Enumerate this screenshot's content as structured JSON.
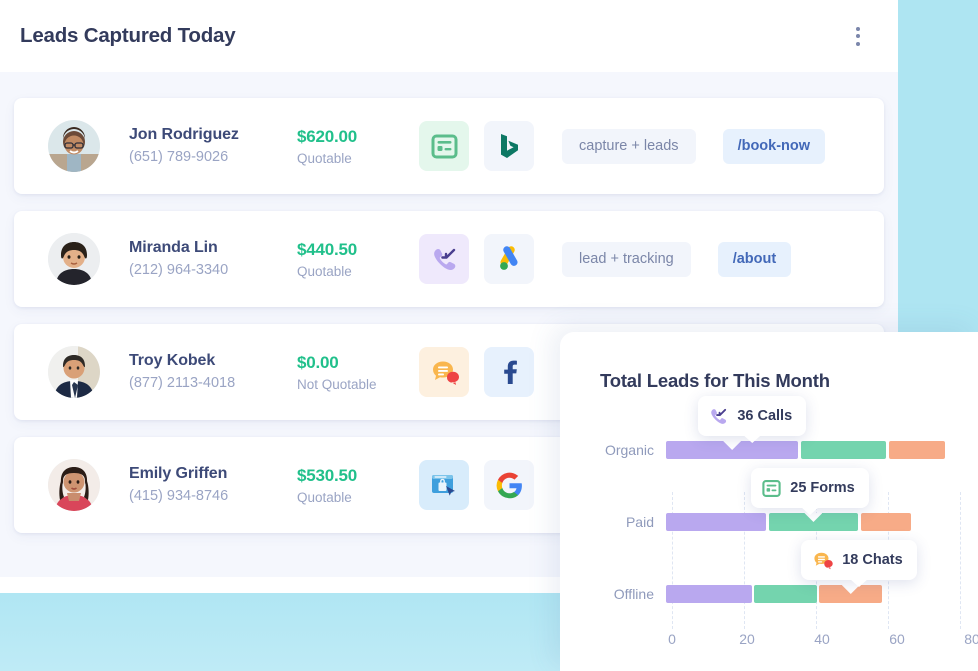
{
  "header": {
    "title": "Leads Captured Today",
    "menu_icon": "kebab-menu-icon"
  },
  "leads": [
    {
      "name": "Jon Rodriguez",
      "phone": "(651) 789-9026",
      "amount": "$620.00",
      "status": "Quotable",
      "channel_icon": "form-icon",
      "source_icon": "bing-icon",
      "tag": "capture + leads",
      "page": "/book-now"
    },
    {
      "name": "Miranda Lin",
      "phone": "(212) 964-3340",
      "amount": "$440.50",
      "status": "Quotable",
      "channel_icon": "inbound-call-icon",
      "source_icon": "google-ads-icon",
      "tag": "lead + tracking",
      "page": "/about"
    },
    {
      "name": "Troy Kobek",
      "phone": "(877) 2113-4018",
      "amount": "$0.00",
      "status": "Not Quotable",
      "channel_icon": "chat-icon",
      "source_icon": "facebook-icon",
      "tag": "",
      "page": ""
    },
    {
      "name": "Emily Griffen",
      "phone": "(415) 934-8746",
      "amount": "$530.50",
      "status": "Quotable",
      "channel_icon": "click-storefront-icon",
      "source_icon": "google-icon",
      "tag": "",
      "page": ""
    }
  ],
  "chart_panel": {
    "title": "Total Leads for This Month"
  },
  "chart_data": {
    "type": "bar",
    "orientation": "horizontal",
    "stacked": true,
    "title": "Total Leads for This Month",
    "categories": [
      "Organic",
      "Paid",
      "Offline"
    ],
    "series": [
      {
        "name": "Calls",
        "color": "#b9a8ef",
        "values": [
          36,
          28,
          24
        ]
      },
      {
        "name": "Forms",
        "color": "#74d4ae",
        "values": [
          24,
          25,
          18
        ]
      },
      {
        "name": "Chats",
        "color": "#f7ab87",
        "values": [
          16,
          14,
          18
        ]
      }
    ],
    "xlabel": "",
    "ylabel": "",
    "xlim": [
      0,
      80
    ],
    "xticks": [
      0,
      20,
      40,
      60,
      80
    ],
    "grid": true,
    "legend": false,
    "annotations": [
      {
        "label": "36 Calls",
        "icon": "inbound-call-icon",
        "category": "Organic",
        "series": "Calls"
      },
      {
        "label": "25 Forms",
        "icon": "form-icon",
        "category": "Paid",
        "series": "Forms"
      },
      {
        "label": "18 Chats",
        "icon": "chat-icon",
        "category": "Offline",
        "series": "Chats"
      }
    ]
  },
  "colors": {
    "calls": "#b9a8ef",
    "forms": "#74d4ae",
    "chats": "#f7ab87",
    "money": "#21c08b",
    "title": "#333b5c",
    "muted": "#9aa4c4",
    "link": "#4268b8",
    "backdrop_cyan": "#aee5f2",
    "backdrop_lavender": "#f5f7fd"
  }
}
